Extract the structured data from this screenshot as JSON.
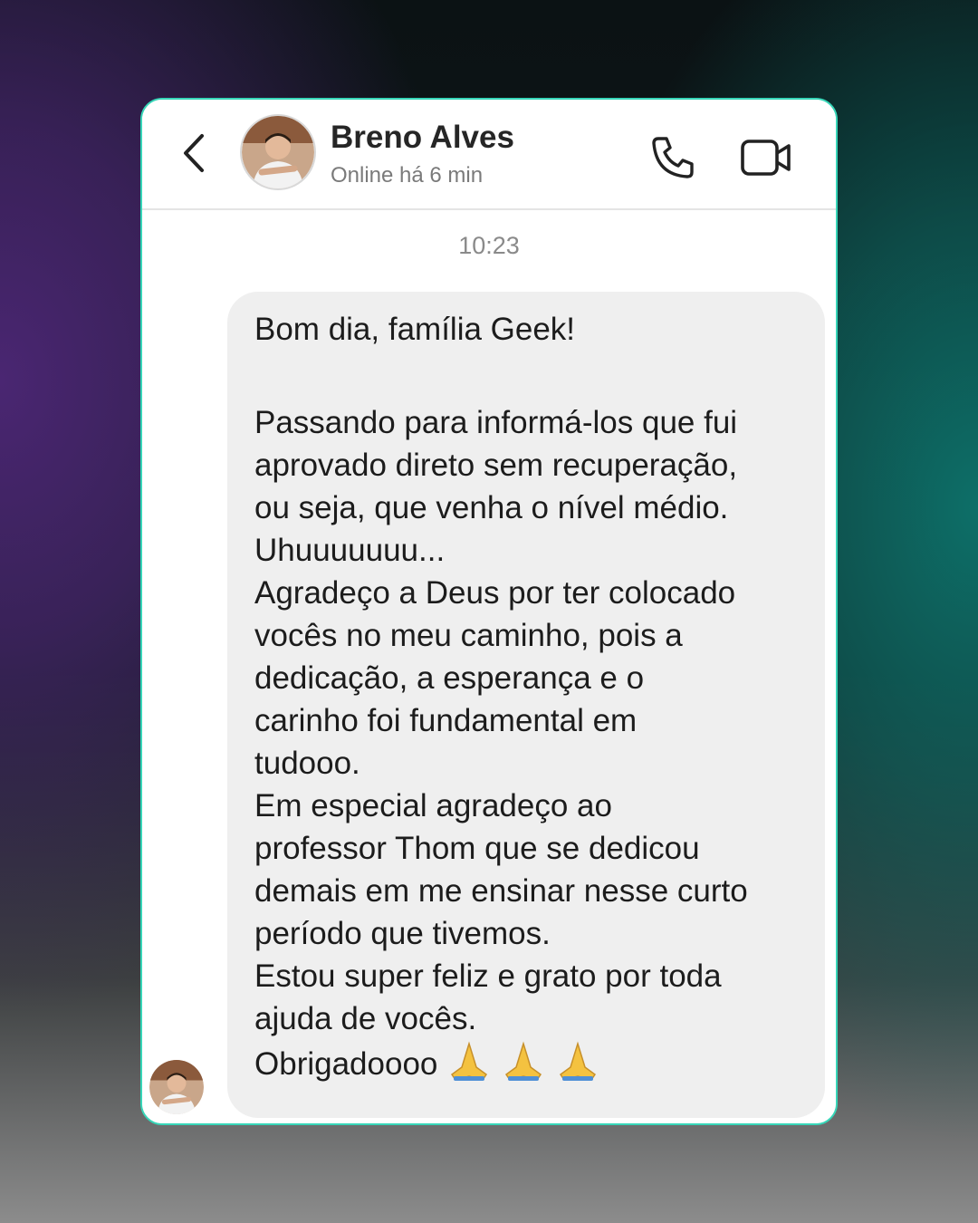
{
  "header": {
    "back_icon": "chevron-left-icon",
    "contact_name": "Breno Alves",
    "status": "Online há 6 min",
    "call_icon": "phone-icon",
    "video_icon": "video-camera-icon"
  },
  "chat": {
    "timestamp": "10:23",
    "message": {
      "lines": [
        "Bom dia, família Geek!",
        "",
        "Passando para informá-los que fui",
        "aprovado direto sem recuperação,",
        "ou seja, que venha o nível médio.",
        "Uhuuuuuuu...",
        "Agradeço a Deus por ter colocado",
        "vocês no meu caminho, pois a",
        "dedicação, a esperança e o",
        "carinho foi fundamental em",
        "tudooo.",
        "Em especial agradeço ao",
        "professor Thom que se dedicou",
        "demais em me ensinar nesse curto",
        "período que tivemos.",
        "Estou super feliz e grato por toda",
        "ajuda de vocês.",
        "Obrigadoooo"
      ],
      "emoji": "folded-hands-icon"
    }
  },
  "colors": {
    "card_border": "#37d6b8",
    "bubble": "#efefef",
    "text": "#1c1c1c",
    "muted": "#7a7a7a"
  }
}
